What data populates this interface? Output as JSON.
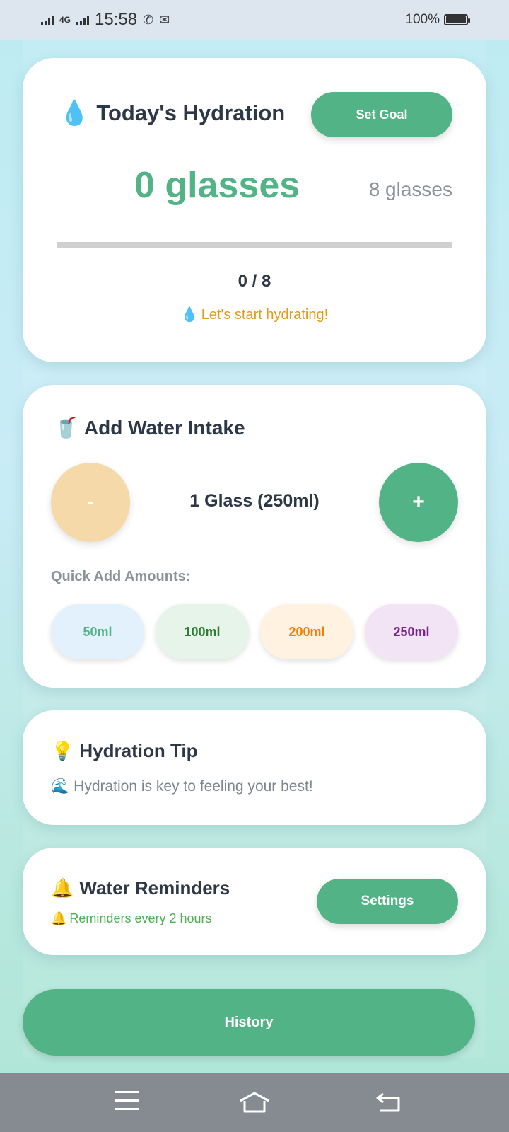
{
  "status_bar": {
    "network": "4G",
    "time": "15:58",
    "battery": "100%",
    "icons": [
      "signal-icon",
      "whatsapp-icon",
      "gmail-icon",
      "battery-icon"
    ]
  },
  "hydration_card": {
    "title": "Today's Hydration",
    "set_goal_label": "Set Goal",
    "current": "0 glasses",
    "goal": "8 glasses",
    "progress_fraction": 0,
    "count_text": "0 / 8",
    "status_text": "Let's start hydrating!"
  },
  "intake_card": {
    "title": "Add Water Intake",
    "minus_label": "-",
    "plus_label": "+",
    "amount_text": "1 Glass (250ml)",
    "quick_add_label": "Quick Add Amounts:",
    "quick_amounts": [
      "50ml",
      "100ml",
      "200ml",
      "250ml"
    ]
  },
  "tip_card": {
    "title": "Hydration Tip",
    "tip": "Hydration is key to feeling your best!"
  },
  "reminders_card": {
    "title": "Water Reminders",
    "subtitle": "Reminders every 2 hours",
    "settings_label": "Settings"
  },
  "history_label": "History",
  "colors": {
    "accent": "#51b386",
    "status_orange": "#e09a1a",
    "reminder_green": "#4caf50"
  }
}
